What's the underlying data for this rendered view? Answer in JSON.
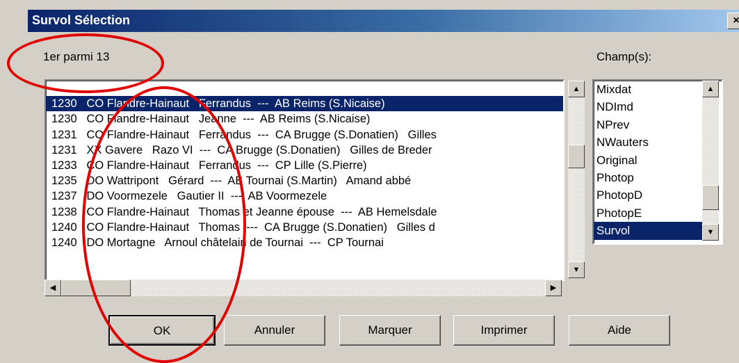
{
  "dialog": {
    "title": "Survol Sélection",
    "close_glyph": "×"
  },
  "status": {
    "position_text": "1er parmi 13"
  },
  "fields": {
    "label": "Champ(s):",
    "items": [
      "Mixdat",
      "NDImd",
      "NPrev",
      "NWauters",
      "Original",
      "Photop",
      "PhotopD",
      "PhotopE",
      "Survol"
    ],
    "selected": "Survol"
  },
  "records": {
    "selected_index": 1,
    "rows": [
      "",
      "1230   CO Flandre-Hainaut   Ferrandus  ---  AB Reims (S.Nicaise)",
      "1230   CO Flandre-Hainaut   Jeanne  ---  AB Reims (S.Nicaise)",
      "1231   CO Flandre-Hainaut   Ferrandus  ---  CA Brugge (S.Donatien)   Gilles",
      "1231   XX Gavere   Razo VI  ---  CA Brugge (S.Donatien)   Gilles de Breder",
      "1233   CO Flandre-Hainaut   Ferrandus  ---  CP Lille (S.Pierre)",
      "1235   DO Wattripont   Gérard  ---  AB Tournai (S.Martin)   Amand abbé",
      "1237   DO Voormezele   Gautier II  ---  AB Voormezele",
      "1238   CO Flandre-Hainaut   Thomas et Jeanne épouse  ---  AB Hemelsdale",
      "1240   CO Flandre-Hainaut   Thomas  ---  CA Brugge (S.Donatien)   Gilles d",
      "1240   DO Mortagne   Arnoul châtelain de Tournai  ---  CP Tournai"
    ]
  },
  "buttons": {
    "ok": "OK",
    "cancel": "Annuler",
    "mark": "Marquer",
    "print": "Imprimer",
    "help": "Aide"
  },
  "colors": {
    "selection": "#0a246a",
    "annotation": "#e00000",
    "face": "#d4d0c8"
  }
}
